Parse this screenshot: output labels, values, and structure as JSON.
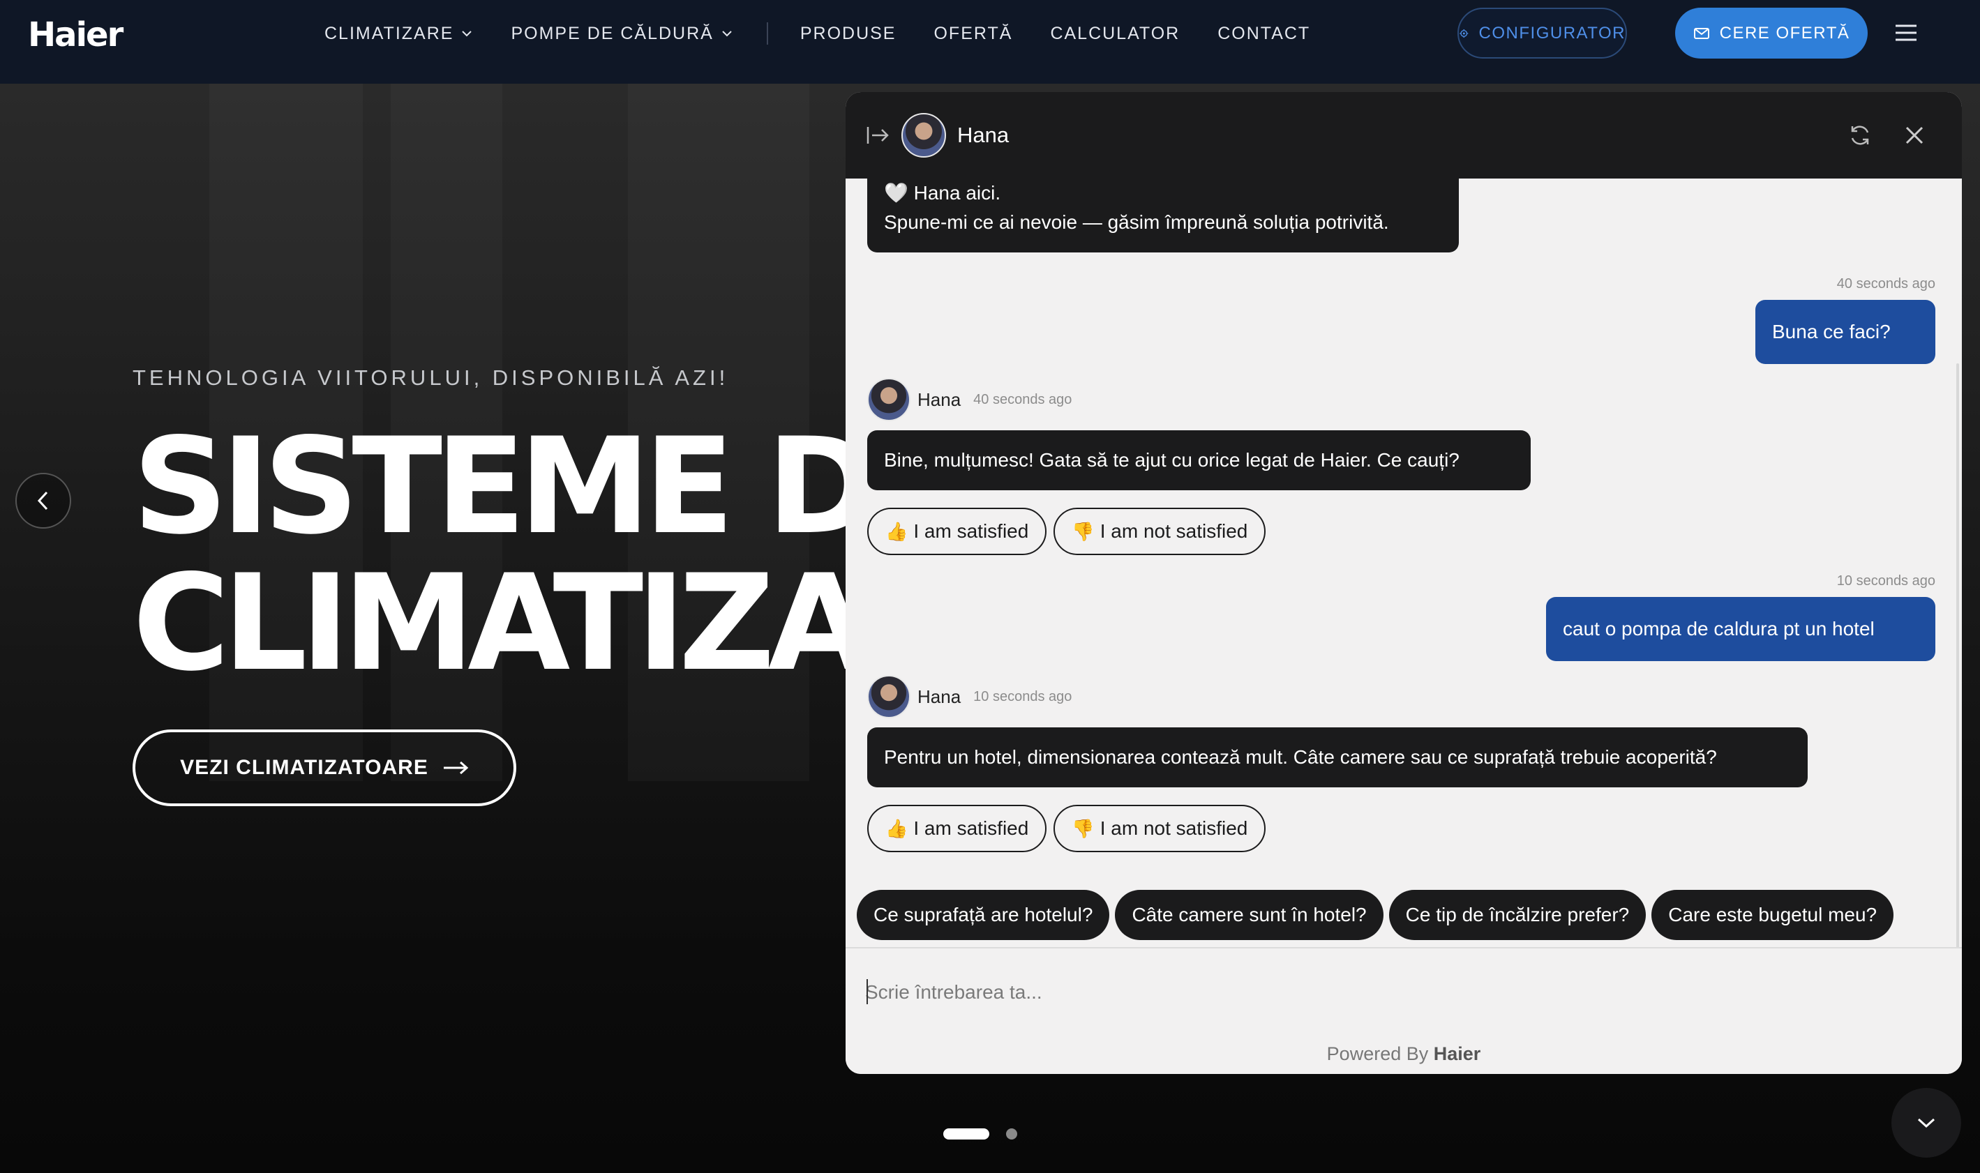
{
  "header": {
    "logo": "Haier",
    "nav": [
      {
        "label": "CLIMATIZARE",
        "dropdown": true
      },
      {
        "label": "POMPE DE CĂLDURĂ",
        "dropdown": true
      },
      {
        "label": "PRODUSE",
        "dropdown": false
      },
      {
        "label": "OFERTĂ",
        "dropdown": false
      },
      {
        "label": "CALCULATOR",
        "dropdown": false
      },
      {
        "label": "CONTACT",
        "dropdown": false
      }
    ],
    "configurator_label": "CONFIGURATOR",
    "offer_label": "CERE OFERTĂ"
  },
  "hero": {
    "eyebrow": "TEHNOLOGIA VIITORULUI, DISPONIBILĂ AZI!",
    "title_line1": "SISTEME DE",
    "title_line2": "CLIMATIZARE",
    "cta_label": "VEZI CLIMATIZATOARE",
    "slides_total": 2,
    "slide_active": 1
  },
  "chat": {
    "agent_name": "Hana",
    "messages": {
      "intro_line1": "🤍 Hana aici.",
      "intro_line2": "Spune-mi ce ai nevoie — găsim împreună soluția potrivită.",
      "user1_time": "40 seconds ago",
      "user1_text": "Buna ce faci?",
      "bot1_time": "40 seconds ago",
      "bot1_text": "Bine, mulțumesc! Gata să te ajut cu orice legat de Haier. Ce cauți?",
      "user2_time": "10 seconds ago",
      "user2_text": "caut o pompa de caldura pt un hotel",
      "bot2_time": "10 seconds ago",
      "bot2_text": "Pentru un hotel, dimensionarea contează mult. Câte camere sau ce suprafață trebuie acoperită?"
    },
    "feedback": {
      "satisfied_emoji": "👍",
      "satisfied": "I am satisfied",
      "not_satisfied_emoji": "👎",
      "not_satisfied": "I am not satisfied"
    },
    "suggestions": [
      "Ce suprafață are hotelul?",
      "Câte camere sunt în hotel?",
      "Ce tip de încălzire prefer?",
      "Care este bugetul meu?"
    ],
    "input_placeholder": "Scrie întrebarea ta...",
    "powered_prefix": "Powered By",
    "powered_brand": "Haier"
  },
  "colors": {
    "header_bg": "#0f1726",
    "accent_blue": "#2f7fd9",
    "user_bubble": "#1e4d9e",
    "bot_bubble": "#1b1b1c"
  }
}
